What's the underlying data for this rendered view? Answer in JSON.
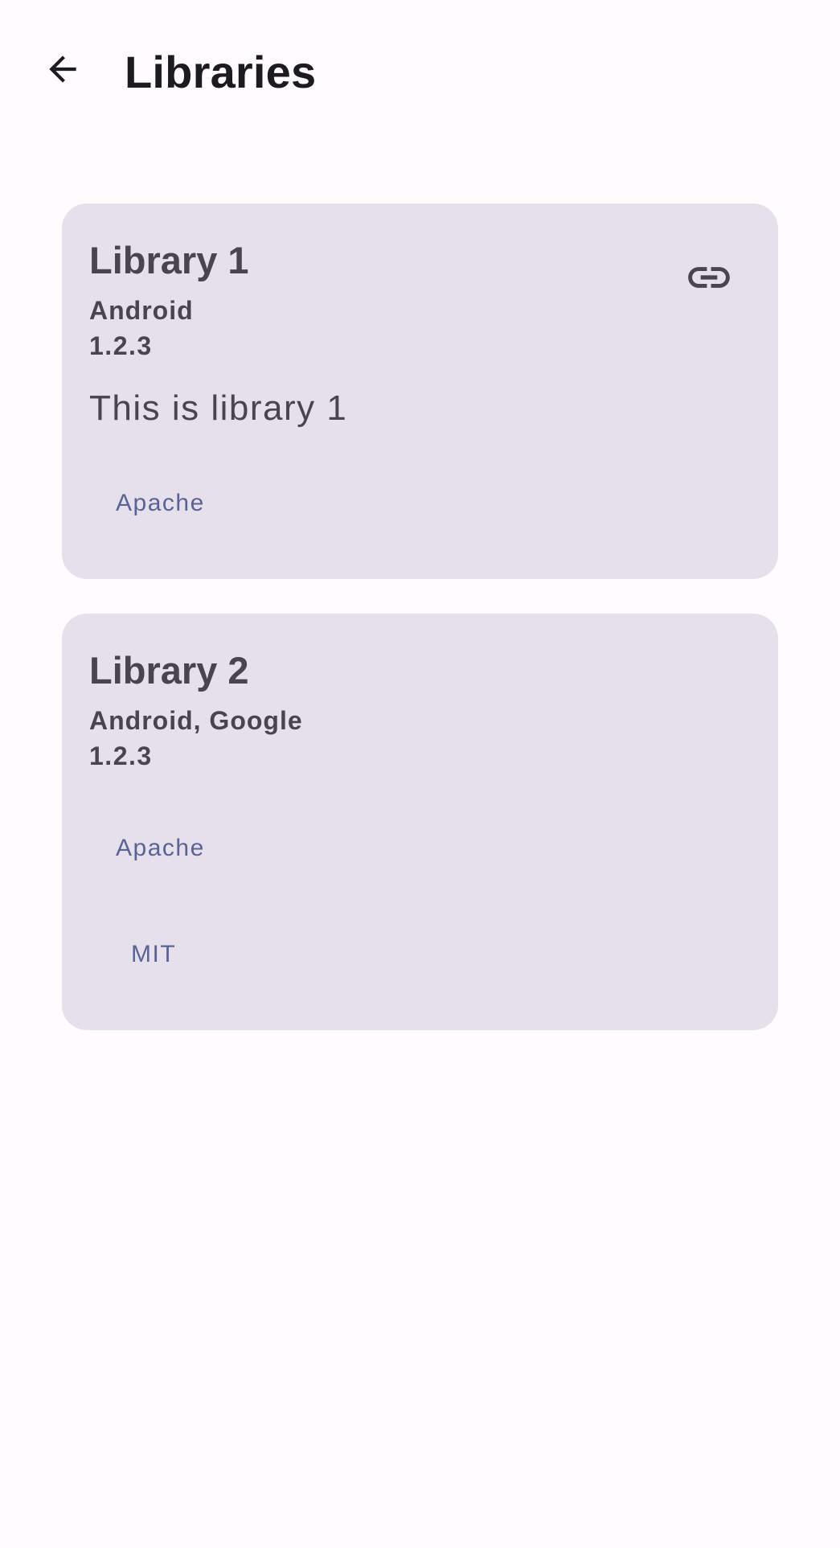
{
  "app": {
    "title": "Libraries"
  },
  "header": {
    "back_icon": "arrow-left-icon",
    "title": "Libraries"
  },
  "libraries": [
    {
      "name": "Library 1",
      "authors": "Android",
      "version": "1.2.3",
      "description": "This is library 1",
      "link_icon": "link-icon",
      "licenses": [
        "Apache"
      ]
    },
    {
      "name": "Library 2",
      "authors": "Android, Google",
      "version": "1.2.3",
      "licenses": [
        "Apache",
        "MIT"
      ]
    }
  ],
  "colors": {
    "background": "#fffbfe",
    "card": "#e6e0ea",
    "text_primary": "#1c1b1f",
    "text_secondary": "#49454f",
    "license_accent": "#5a6298"
  }
}
